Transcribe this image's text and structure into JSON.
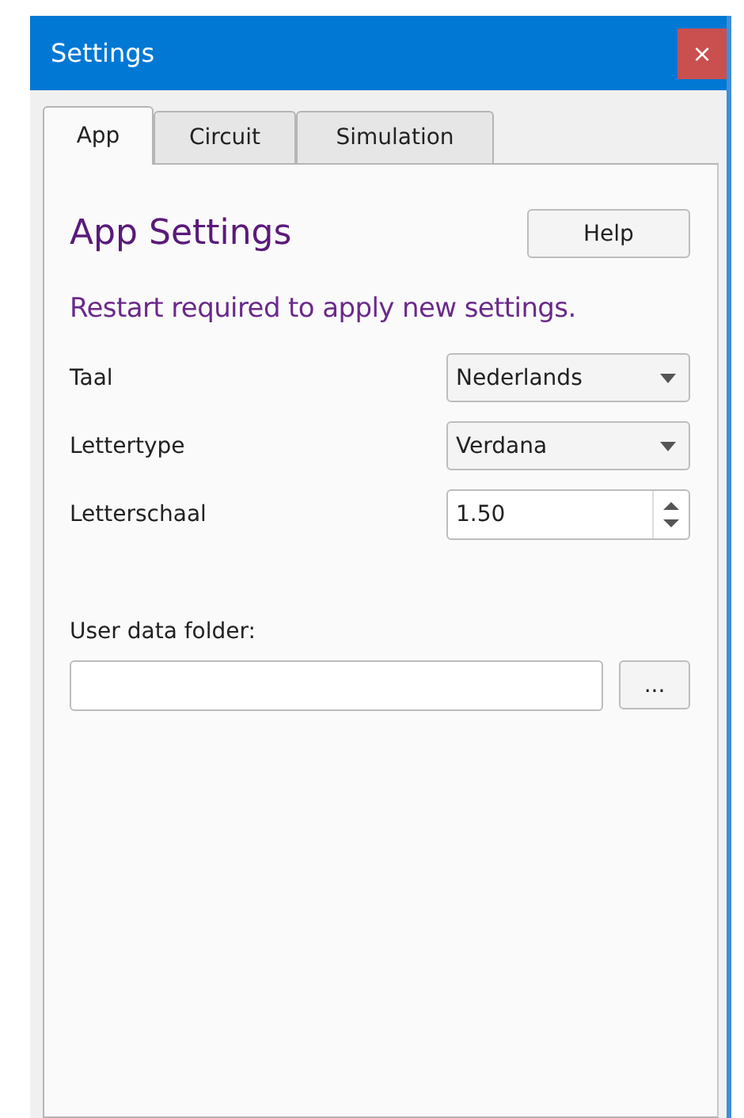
{
  "window": {
    "title": "Settings",
    "close": "×"
  },
  "tabs": [
    {
      "label": "App",
      "selected": true
    },
    {
      "label": "Circuit",
      "selected": false
    },
    {
      "label": "Simulation",
      "selected": false
    }
  ],
  "panel": {
    "heading": "App Settings",
    "help_button": "Help",
    "notice": "Restart required to apply new settings.",
    "settings": [
      {
        "kind": "dropdown",
        "label": "Taal",
        "value": "Nederlands"
      },
      {
        "kind": "dropdown",
        "label": "Lettertype",
        "value": "Verdana"
      },
      {
        "kind": "spinner",
        "label": "Letterschaal",
        "value": "1.50"
      }
    ],
    "folder": {
      "label": "User data folder:",
      "browse_button": "..."
    }
  }
}
